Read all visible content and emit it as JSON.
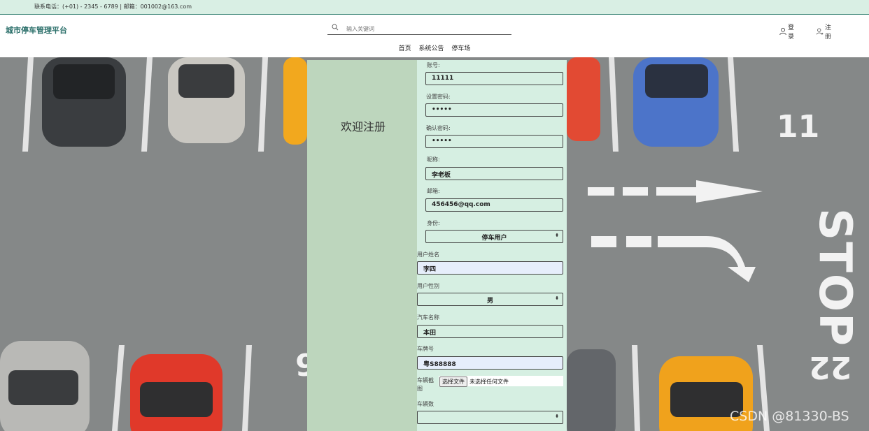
{
  "topbar": {
    "contact": "联系电话：(+01) - 2345 - 6789 | 邮箱：001002@163.com"
  },
  "brand": "城市停车管理平台",
  "search": {
    "placeholder": "输入关键词"
  },
  "user": {
    "login": "登录",
    "register": "注册"
  },
  "nav": [
    "首页",
    "系统公告",
    "停车场"
  ],
  "welcome": "欢迎注册",
  "form": {
    "account": {
      "label": "账号:",
      "value": "11111"
    },
    "password": {
      "label": "设置密码:",
      "value": "•••••"
    },
    "confirm": {
      "label": "确认密码:",
      "value": "•••••"
    },
    "nickname": {
      "label": "昵称:",
      "value": "李老板"
    },
    "email": {
      "label": "邮箱:",
      "value": "456456@qq.com"
    },
    "role": {
      "label": "身份:",
      "value": "停车用户"
    },
    "username": {
      "label": "用户姓名",
      "value": "李四"
    },
    "gender": {
      "label": "用户性别",
      "value": "男"
    },
    "carname": {
      "label": "汽车名称",
      "value": "本田"
    },
    "plate": {
      "label": "车牌号",
      "value": "粤S88888"
    },
    "image": {
      "label": "车辆截图",
      "button": "选择文件",
      "status": "未选择任何文件"
    },
    "carcount": {
      "label": "车辆数",
      "value": ""
    }
  },
  "watermark": "CSDN @81330-BS",
  "colors": {
    "topbar": "#d9efe4",
    "brand": "#2b6f6a",
    "panel": "#d6efe2",
    "panel_left": "#bdd6bd"
  },
  "background_text": [
    "11",
    "STOP",
    "9",
    "22"
  ]
}
